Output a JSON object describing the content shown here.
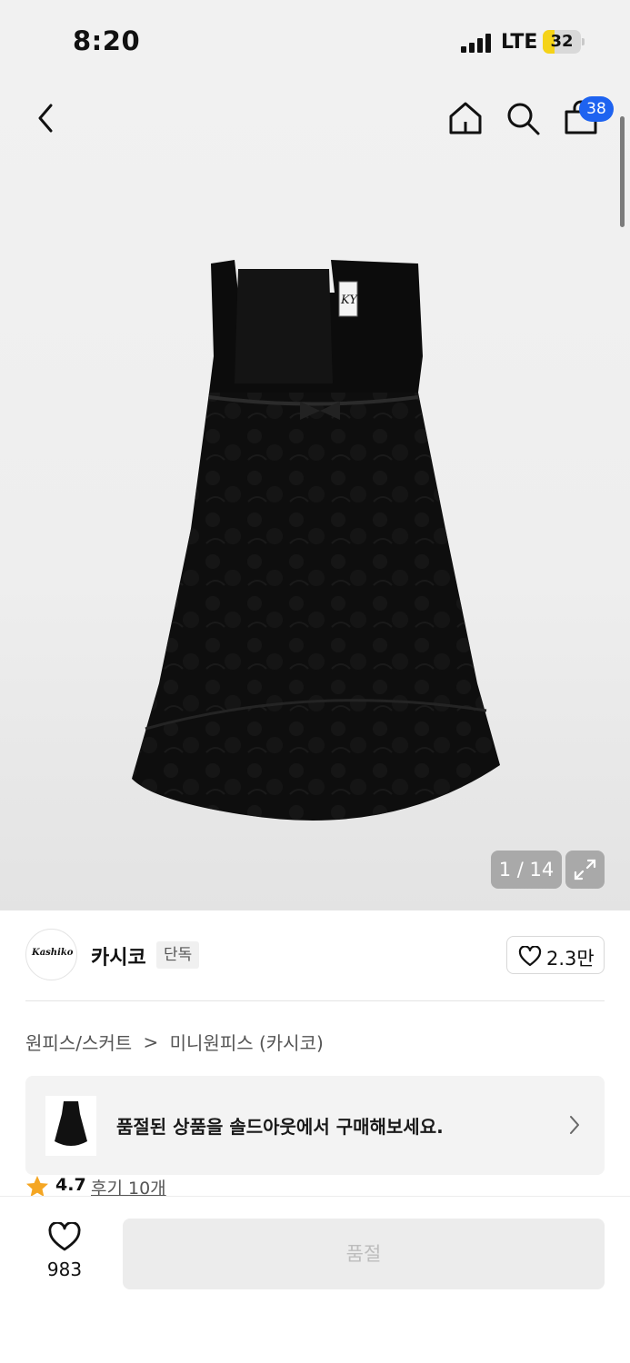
{
  "status_bar": {
    "time": "8:20",
    "network": "LTE",
    "battery": "32",
    "battery_level": 0.32
  },
  "nav": {
    "back_icon": "chevron-left-icon",
    "home_icon": "home-icon",
    "search_icon": "search-icon",
    "cart_icon": "shopping-bag-icon",
    "cart_count": "38"
  },
  "gallery": {
    "page_indicator": "1 / 14",
    "expand_icon": "expand-icon",
    "logo_tag": "KY"
  },
  "brand": {
    "logo_text": "Kashiko",
    "name": "카시코",
    "badge": "단독",
    "likes": "2.3만"
  },
  "breadcrumb": {
    "category": "원피스/스커트",
    "separator": ">",
    "subcategory": "미니원피스 (카시코)"
  },
  "soldout_banner": {
    "message": "품절된 상품을 솔드아웃에서 구매해보세요."
  },
  "rating": {
    "score": "4.7",
    "reviews": "후기 10개"
  },
  "bottom": {
    "wish_count": "983",
    "cta_label": "품절"
  },
  "colors": {
    "accent_blue": "#1e63f0",
    "battery_yellow": "#f5d318",
    "star": "#f5a623",
    "disabled_bg": "#ececec",
    "disabled_text": "#bdbdbd"
  }
}
